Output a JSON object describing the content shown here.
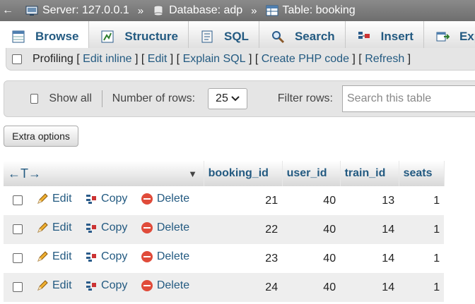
{
  "breadcrumb": {
    "back_symbol": "←",
    "separator": "»",
    "server": "Server: 127.0.0.1",
    "database": "Database: adp",
    "table": "Table: booking"
  },
  "tabs": [
    {
      "label": "Browse",
      "icon": "browse-icon",
      "active": true
    },
    {
      "label": "Structure",
      "icon": "structure-icon",
      "active": false
    },
    {
      "label": "SQL",
      "icon": "sql-icon",
      "active": false
    },
    {
      "label": "Search",
      "icon": "search-icon",
      "active": false
    },
    {
      "label": "Insert",
      "icon": "insert-icon",
      "active": false
    },
    {
      "label": "Export",
      "icon": "export-icon",
      "active": false
    }
  ],
  "profiling": {
    "label": "Profiling",
    "links": [
      "Edit inline",
      "Edit",
      "Explain SQL",
      "Create PHP code",
      "Refresh"
    ]
  },
  "navigation": {
    "show_all_label": "Show all",
    "rows_label": "Number of rows:",
    "rows_value": "25",
    "filter_label": "Filter rows:",
    "filter_placeholder": "Search this table"
  },
  "extra_options_label": "Extra options",
  "table": {
    "header_arrows": "←T→",
    "sort_caret": "▼",
    "columns": [
      "booking_id",
      "user_id",
      "train_id",
      "seats"
    ],
    "actions": {
      "edit": "Edit",
      "copy": "Copy",
      "delete": "Delete"
    },
    "rows": [
      [
        "21",
        "40",
        "13",
        "1"
      ],
      [
        "22",
        "40",
        "14",
        "1"
      ],
      [
        "23",
        "40",
        "14",
        "1"
      ],
      [
        "24",
        "40",
        "14",
        "1"
      ]
    ]
  },
  "colors": {
    "link": "#235a81",
    "breadcrumb_bg": "#7a7a7a",
    "row_alt": "#eeeeee"
  }
}
